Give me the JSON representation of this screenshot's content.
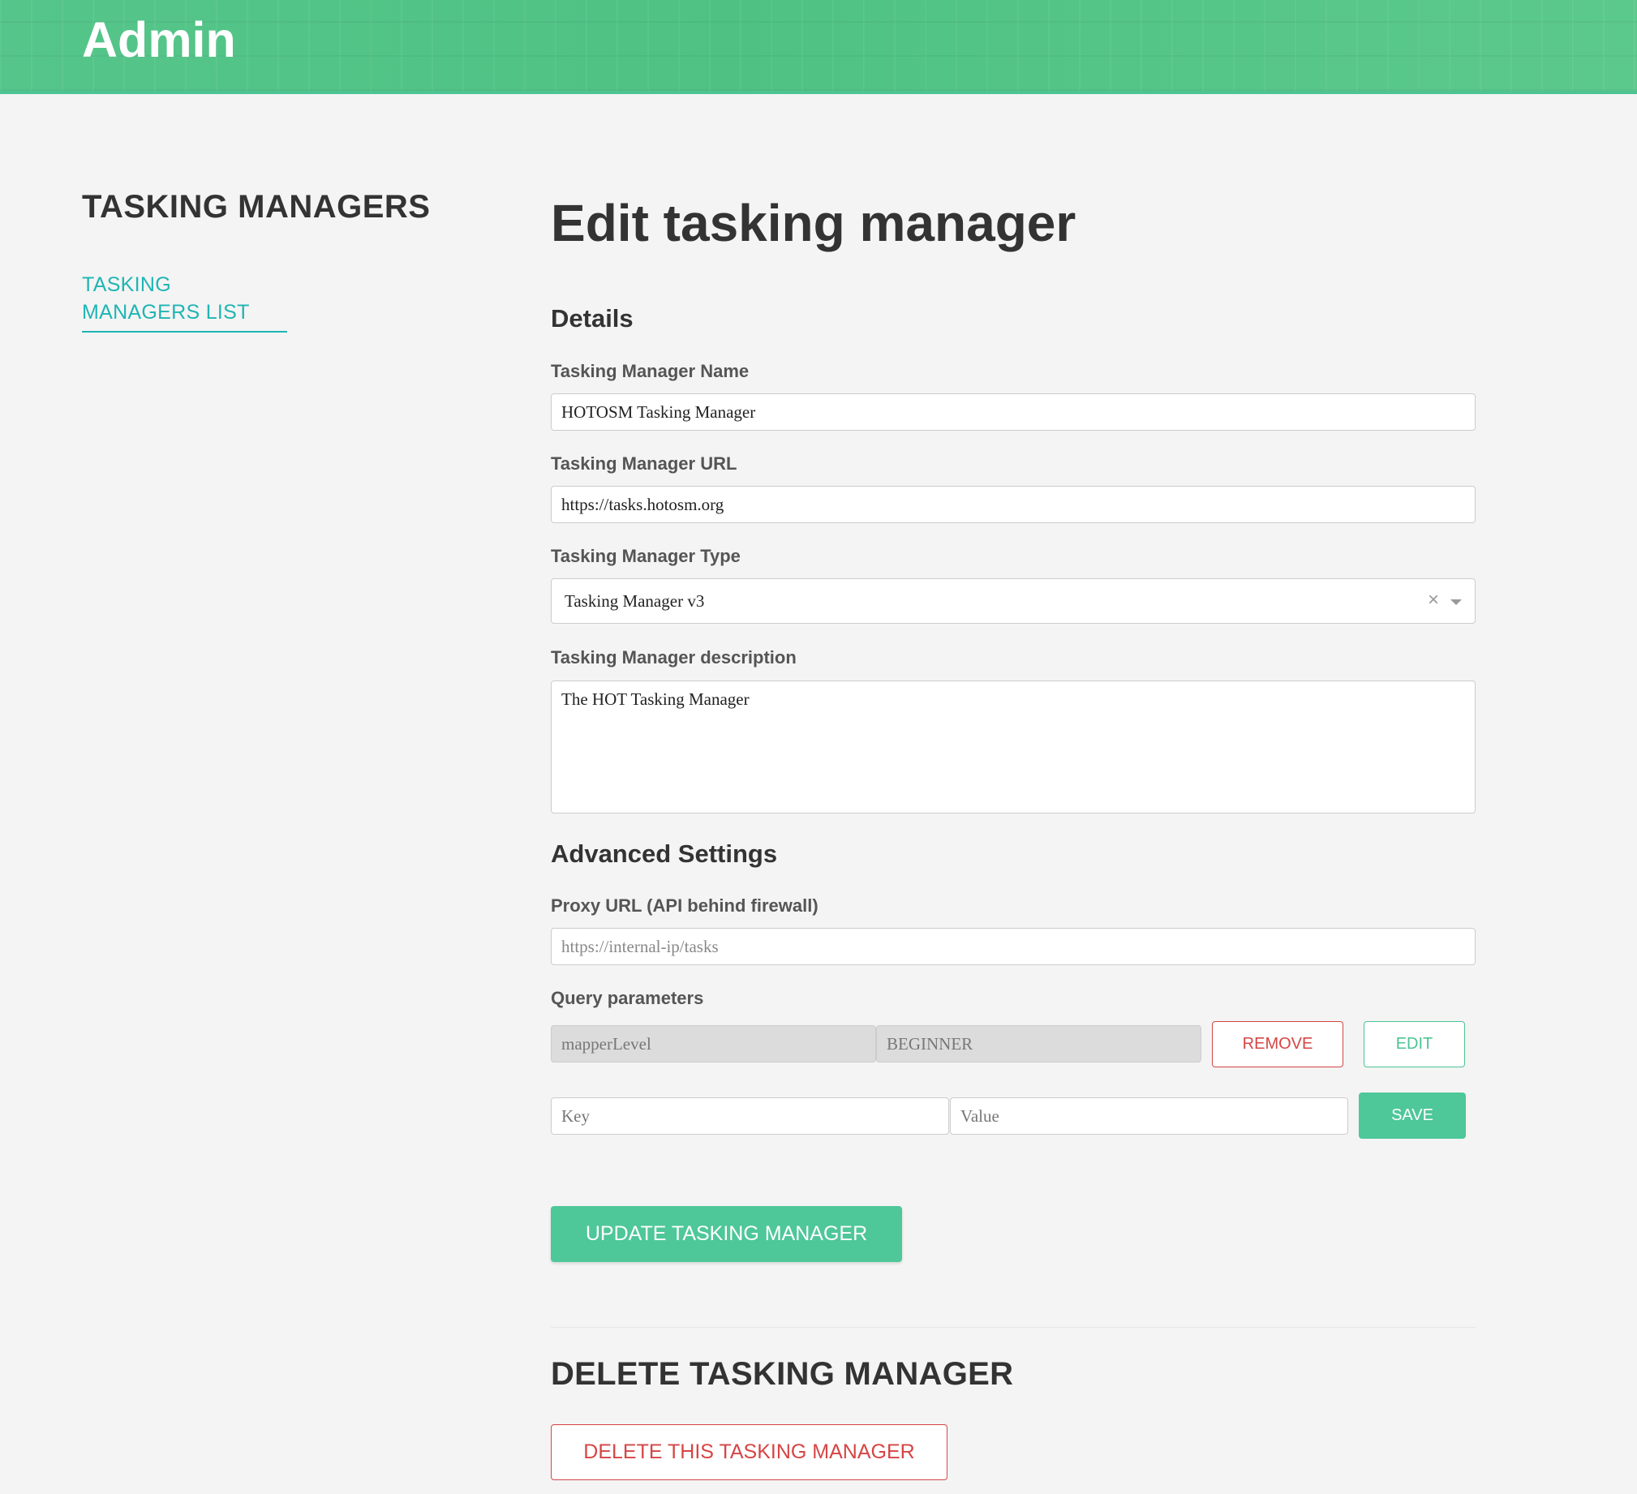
{
  "header": {
    "title": "Admin"
  },
  "sidebar": {
    "title": "TASKING MANAGERS",
    "items": [
      {
        "label": "TASKING MANAGERS LIST"
      }
    ]
  },
  "main": {
    "title": "Edit tasking manager",
    "details": {
      "section_title": "Details",
      "name": {
        "label": "Tasking Manager Name",
        "value": "HOTOSM Tasking Manager"
      },
      "url": {
        "label": "Tasking Manager URL",
        "value": "https://tasks.hotosm.org"
      },
      "type": {
        "label": "Tasking Manager Type",
        "selected": "Tasking Manager v3",
        "clear_glyph": "×"
      },
      "description": {
        "label": "Tasking Manager description",
        "value": "The HOT Tasking Manager"
      }
    },
    "advanced": {
      "section_title": "Advanced Settings",
      "proxy": {
        "label": "Proxy URL (API behind firewall)",
        "value": "",
        "placeholder": "https://internal-ip/tasks"
      },
      "query_params": {
        "label": "Query parameters",
        "rows": [
          {
            "key": "mapperLevel",
            "value": "BEGINNER"
          }
        ],
        "remove_label": "REMOVE",
        "edit_label": "EDIT",
        "new_key_placeholder": "Key",
        "new_value_placeholder": "Value",
        "save_label": "SAVE"
      }
    },
    "update_label": "UPDATE TASKING MANAGER",
    "delete": {
      "title": "DELETE TASKING MANAGER",
      "button_label": "DELETE THIS TASKING MANAGER"
    }
  },
  "colors": {
    "accent_green": "#4ec799",
    "link_teal": "#1fb5b3",
    "danger_red": "#d64545",
    "background": "#f4f4f4"
  }
}
